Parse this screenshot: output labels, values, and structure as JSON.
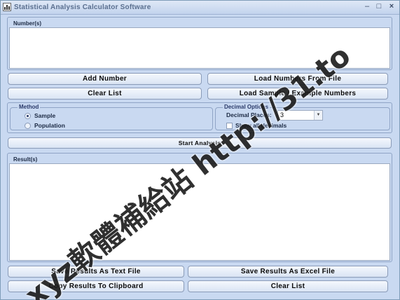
{
  "window": {
    "title": "Statistical Analysis Calculator Software"
  },
  "numbers_panel": {
    "label": "Number(s)"
  },
  "buttons": {
    "add_number": "Add Number",
    "load_from_file": "Load Numbers From File",
    "clear_list": "Clear List",
    "load_sample": "Load Sample / Example Numbers",
    "start_analysis": "Start Analysis",
    "save_text": "Save Results As Text File",
    "save_excel": "Save Results As Excel File",
    "copy_clipboard": "Copy Results To Clipboard",
    "clear_results": "Clear List"
  },
  "method": {
    "legend": "Method",
    "options": [
      "Sample",
      "Population"
    ],
    "selected": "Sample"
  },
  "decimal_options": {
    "legend": "Decimal Options",
    "places_label": "Decimal Places:",
    "places_value": "3",
    "show_all_label": "Show all decimals",
    "show_all_checked": false
  },
  "results_panel": {
    "label": "Result(s)"
  },
  "watermark": {
    "text": "xyz軟體補給站 http://31.to"
  },
  "colors": {
    "window_bg": "#c9d9f1",
    "button_top": "#f5f8fd",
    "button_bottom": "#d9e4f4",
    "border": "#8fa4c6"
  },
  "icons": [
    "app-icon",
    "minimize-icon",
    "maximize-icon",
    "close-icon",
    "dropdown-arrow-icon"
  ]
}
